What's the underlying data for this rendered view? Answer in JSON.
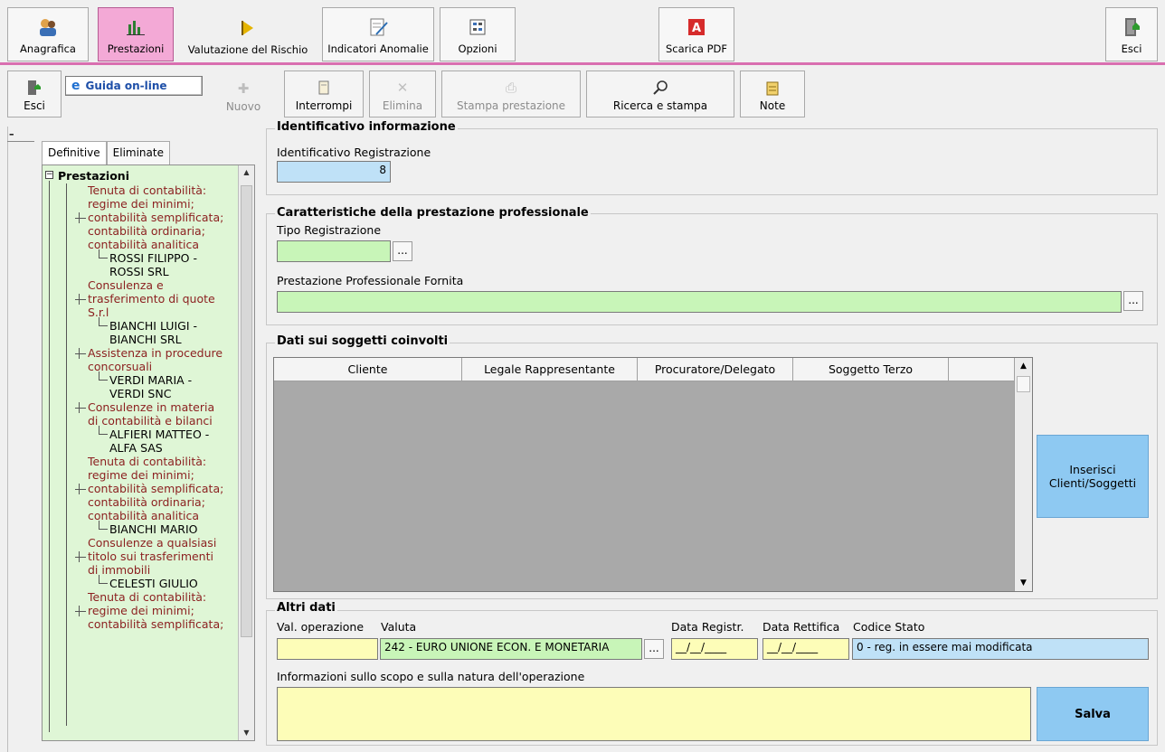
{
  "ribbon": {
    "items": [
      {
        "label": "Anagrafica",
        "icon": "people-icon"
      },
      {
        "label": "Prestazioni",
        "icon": "bar-chart-icon"
      },
      {
        "label": "Valutazione del Rischio",
        "icon": "arrow-flag-icon"
      },
      {
        "label": "Indicatori Anomalie",
        "icon": "edit-sheet-icon"
      },
      {
        "label": "Opzioni",
        "icon": "options-icon"
      },
      {
        "label": "Scarica PDF",
        "icon": "pdf-icon"
      },
      {
        "label": "Esci",
        "icon": "exit-door-icon"
      }
    ],
    "active": "Prestazioni",
    "accent": "#d96fb0"
  },
  "toolbar": {
    "esci": "Esci",
    "guida": "Guida on-line",
    "nuovo": "Nuovo",
    "interrompi": "Interrompi",
    "elimina": "Elimina",
    "stampa": "Stampa prestazione",
    "ricerca": "Ricerca e stampa",
    "note": "Note"
  },
  "tabs": {
    "definitive": "Definitive",
    "eliminate": "Eliminate"
  },
  "tree": {
    "root": "Prestazioni",
    "lines": [
      {
        "text": "Tenuta di contabilità:",
        "kind": "svc"
      },
      {
        "text": "regime dei minimi;",
        "kind": "svc"
      },
      {
        "text": "contabilità semplificata;",
        "kind": "svc"
      },
      {
        "text": "contabilità ordinaria;",
        "kind": "svc"
      },
      {
        "text": "contabilità analitica",
        "kind": "svc"
      },
      {
        "text": "ROSSI FILIPPO -",
        "kind": "client"
      },
      {
        "text": "ROSSI SRL",
        "kind": "client"
      },
      {
        "text": "Consulenza e",
        "kind": "svc"
      },
      {
        "text": "trasferimento di quote",
        "kind": "svc"
      },
      {
        "text": "S.r.l",
        "kind": "svc"
      },
      {
        "text": "BIANCHI LUIGI -",
        "kind": "client"
      },
      {
        "text": "BIANCHI SRL",
        "kind": "client"
      },
      {
        "text": "Assistenza in procedure",
        "kind": "svc"
      },
      {
        "text": "concorsuali",
        "kind": "svc"
      },
      {
        "text": "VERDI MARIA -",
        "kind": "client"
      },
      {
        "text": "VERDI SNC",
        "kind": "client"
      },
      {
        "text": "Consulenze in materia",
        "kind": "svc"
      },
      {
        "text": "di contabilità e bilanci",
        "kind": "svc"
      },
      {
        "text": "ALFIERI MATTEO -",
        "kind": "client"
      },
      {
        "text": "ALFA SAS",
        "kind": "client"
      },
      {
        "text": "Tenuta di contabilità:",
        "kind": "svc"
      },
      {
        "text": "regime dei minimi;",
        "kind": "svc"
      },
      {
        "text": "contabilità semplificata;",
        "kind": "svc"
      },
      {
        "text": "contabilità ordinaria;",
        "kind": "svc"
      },
      {
        "text": "contabilità analitica",
        "kind": "svc"
      },
      {
        "text": "BIANCHI MARIO",
        "kind": "client"
      },
      {
        "text": "Consulenze a qualsiasi",
        "kind": "svc"
      },
      {
        "text": "titolo sui trasferimenti",
        "kind": "svc"
      },
      {
        "text": "di immobili",
        "kind": "svc"
      },
      {
        "text": "CELESTI GIULIO",
        "kind": "client"
      },
      {
        "text": "Tenuta di contabilità:",
        "kind": "svc"
      },
      {
        "text": "regime dei minimi;",
        "kind": "svc"
      },
      {
        "text": "contabilità semplificata;",
        "kind": "svc"
      }
    ]
  },
  "identificativo": {
    "title": "Identificativo informazione",
    "label": "Identificativo Registrazione",
    "value": "8"
  },
  "caratteristiche": {
    "title": "Caratteristiche della prestazione professionale",
    "tipo_label": "Tipo Registrazione",
    "tipo_value": "",
    "prestazione_label": "Prestazione Professionale Fornita",
    "prestazione_value": "",
    "dots": "..."
  },
  "soggetti": {
    "title": "Dati sui soggetti coinvolti",
    "columns": [
      "Cliente",
      "Legale Rappresentante",
      "Procuratore/Delegato",
      "Soggetto Terzo"
    ],
    "inserisci": "Inserisci Clienti/Soggetti"
  },
  "altri": {
    "title": "Altri dati",
    "val_label": "Val. operazione",
    "val_value": "",
    "valuta_label": "Valuta",
    "valuta_value": "242 - EURO UNIONE ECON. E MONETARIA",
    "data_reg_label": "Data Registr.",
    "data_reg_value": "__/__/____",
    "data_ret_label": "Data Rettifica",
    "data_ret_value": "__/__/____",
    "codice_label": "Codice Stato",
    "codice_value": "0 - reg. in essere mai modificata",
    "info_label": "Informazioni sullo scopo e sulla natura dell'operazione",
    "info_value": "",
    "salva": "Salva"
  }
}
